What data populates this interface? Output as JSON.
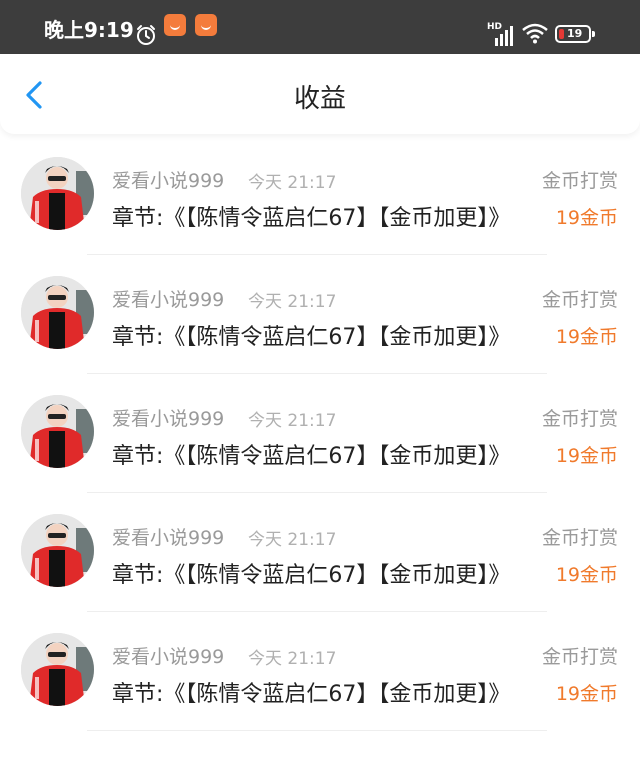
{
  "status_bar": {
    "time": "晚上9:19",
    "network": "HD",
    "battery": "19",
    "icons": [
      "alarm-icon",
      "app-notification-icon",
      "app-notification-icon",
      "signal-icon",
      "wifi-icon",
      "battery-icon"
    ]
  },
  "header": {
    "title": "收益",
    "back_icon": "chevron-left-icon"
  },
  "colors": {
    "status_bar_bg": "#3d3d3d",
    "accent": "#f07a2c",
    "back_arrow": "#2196f3",
    "secondary_text": "#9a9a9a",
    "badge": "#f47c3c"
  },
  "items": [
    {
      "user": "爱看小说999",
      "time": "今天 21:17",
      "type": "金币打赏",
      "chapter": "章节:《【陈情令蓝启仁67】【金币加更】》",
      "amount": "19金币"
    },
    {
      "user": "爱看小说999",
      "time": "今天 21:17",
      "type": "金币打赏",
      "chapter": "章节:《【陈情令蓝启仁67】【金币加更】》",
      "amount": "19金币"
    },
    {
      "user": "爱看小说999",
      "time": "今天 21:17",
      "type": "金币打赏",
      "chapter": "章节:《【陈情令蓝启仁67】【金币加更】》",
      "amount": "19金币"
    },
    {
      "user": "爱看小说999",
      "time": "今天 21:17",
      "type": "金币打赏",
      "chapter": "章节:《【陈情令蓝启仁67】【金币加更】》",
      "amount": "19金币"
    },
    {
      "user": "爱看小说999",
      "time": "今天 21:17",
      "type": "金币打赏",
      "chapter": "章节:《【陈情令蓝启仁67】【金币加更】》",
      "amount": "19金币"
    }
  ]
}
